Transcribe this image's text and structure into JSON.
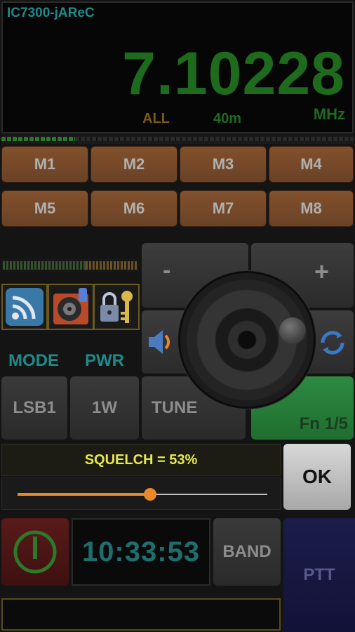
{
  "display": {
    "device_name": "IC7300-jAReC",
    "frequency": "7.10228",
    "unit": "MHz",
    "antenna": "ALL",
    "band": "40m"
  },
  "memories": [
    "M1",
    "M2",
    "M3",
    "M4",
    "M5",
    "M6",
    "M7",
    "M8"
  ],
  "controls": {
    "mode_label": "MODE",
    "pwr_label": "PWR",
    "mode_value": "LSB1",
    "pwr_value": "1W",
    "tune": "TUNE",
    "minus": "-",
    "plus": "+",
    "fn": "Fn 1/5"
  },
  "squelch": {
    "label": "SQUELCH = 53%",
    "level_percent": 53,
    "ok": "OK"
  },
  "bottom": {
    "clock": "10:33:53",
    "band": "BAND",
    "ptt": "PTT"
  },
  "icons": [
    "wifi-icon",
    "speaker-icon",
    "lock-key-icon",
    "volume-icon",
    "sync-icon",
    "power-icon"
  ],
  "colors": {
    "frequency": "#1e6b1e",
    "squelch_text": "#e8e84a",
    "slider": "#e8892a",
    "memory": "#6a4226"
  }
}
